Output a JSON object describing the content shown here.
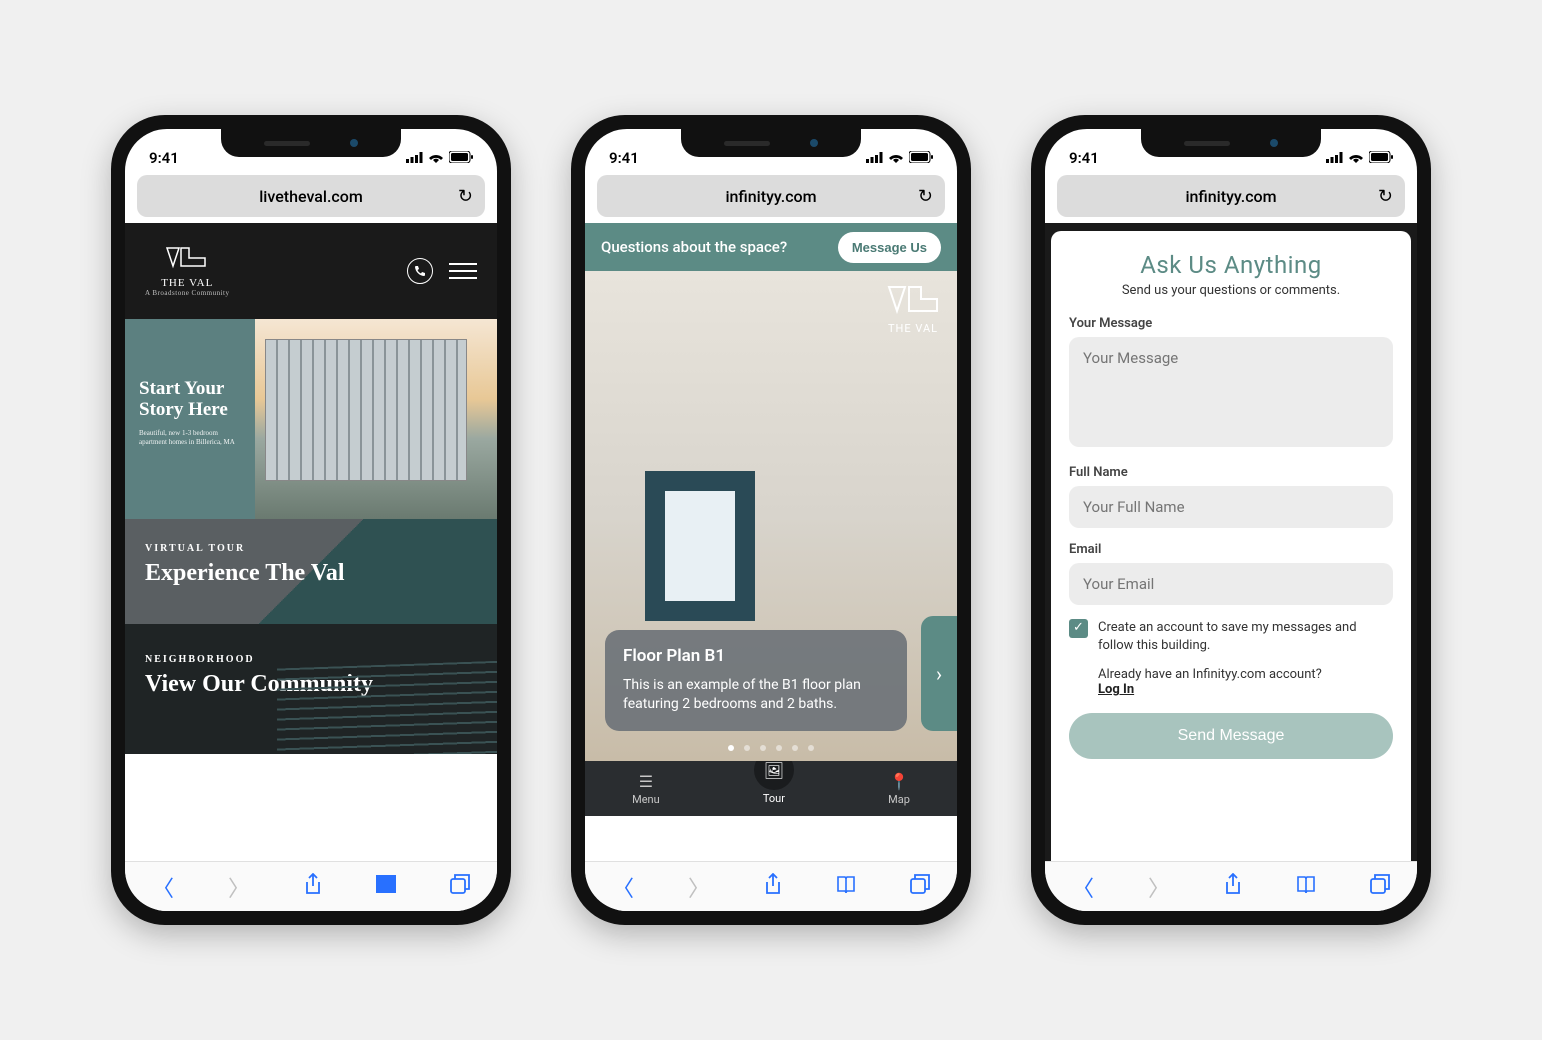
{
  "status": {
    "time": "9:41"
  },
  "phones": [
    {
      "url": "livetheval.com",
      "brand": {
        "logo_text": "THE VAL",
        "logo_sub": "A Broadstone Community"
      },
      "hero": {
        "title": "Start Your Story Here",
        "subtitle": "Beautiful, new 1-3 bedroom apartment homes in Billerica, MA"
      },
      "section_tour": {
        "tag": "VIRTUAL TOUR",
        "title": "Experience The Val"
      },
      "section_neighborhood": {
        "tag": "NEIGHBORHOOD",
        "title": "View Our Community"
      }
    },
    {
      "url": "infinityy.com",
      "banner": {
        "text": "Questions about the space?",
        "button": "Message Us"
      },
      "brand": {
        "logo_text": "THE VAL"
      },
      "card": {
        "title": "Floor Plan B1",
        "body": "This is an example of the B1 floor plan featuring 2 bedrooms and 2 baths."
      },
      "nav": {
        "menu": "Menu",
        "tour": "Tour",
        "map": "Map"
      },
      "dots_total": 6,
      "dots_active_index": 0
    },
    {
      "url": "infinityy.com",
      "form": {
        "title": "Ask Us Anything",
        "subtitle": "Send us your questions or comments.",
        "message_label": "Your Message",
        "message_placeholder": "Your Message",
        "name_label": "Full Name",
        "name_placeholder": "Your Full Name",
        "email_label": "Email",
        "email_placeholder": "Your Email",
        "checkbox_text": "Create an account to save my messages and follow this building.",
        "login_prompt": "Already have an Infinityy.com account?",
        "login_link": "Log In",
        "submit": "Send Message"
      }
    }
  ]
}
